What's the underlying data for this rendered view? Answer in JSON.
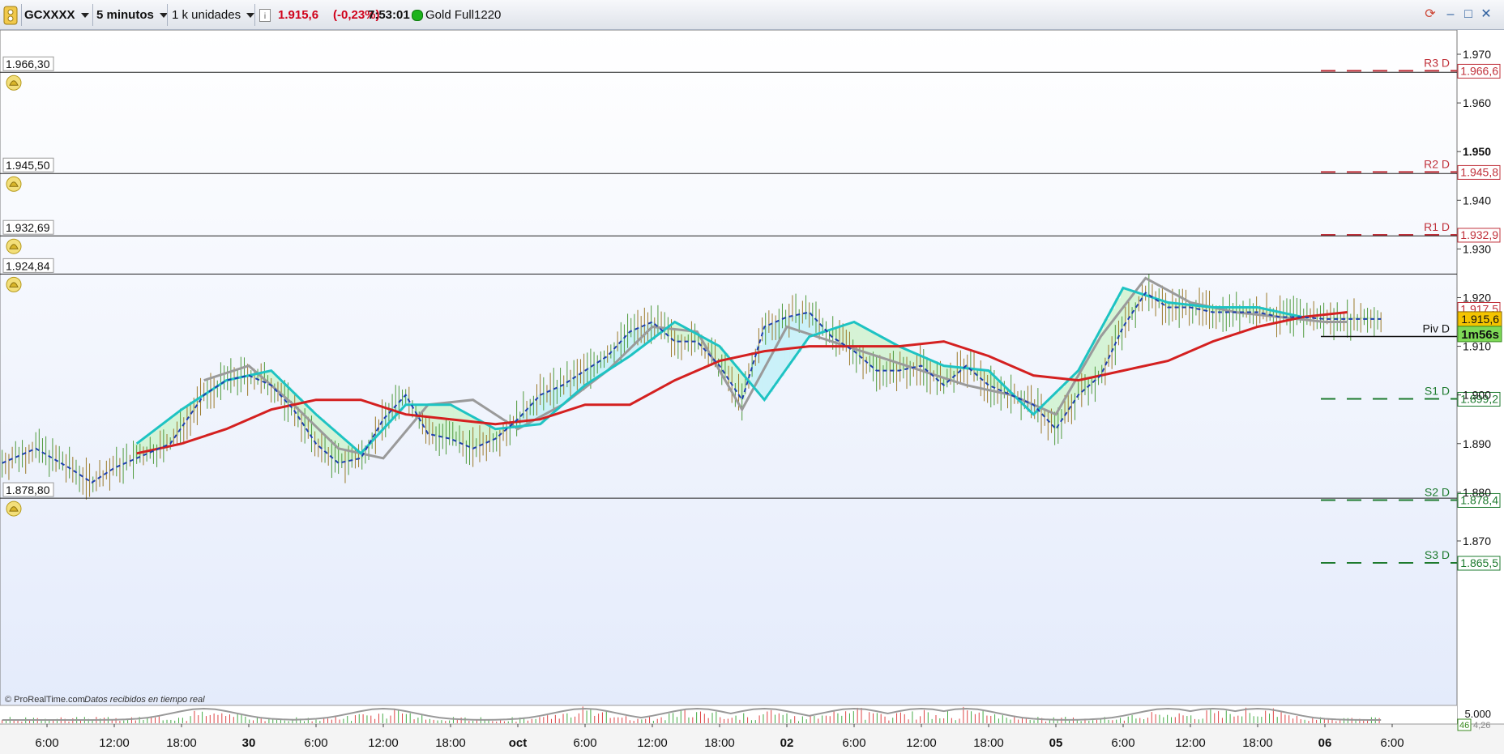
{
  "toolbar": {
    "instrument": "GCXXXX",
    "timeframe": "5 minutos",
    "units": "1 k unidades",
    "info_icon": "info-icon",
    "last_price": "1.915,6",
    "change": "(-0,23%)",
    "time": "7:53:01",
    "product": "Gold Full1220",
    "status_color": "#1db31d",
    "change_color": "#d0021b"
  },
  "footer": {
    "brand": "© ProRealTime.com",
    "note": "Datos recibidos en tiempo real"
  },
  "chart_data": {
    "type": "line",
    "title": "",
    "ylim": [
      1858,
      1975
    ],
    "y_ticks": [
      "1.970",
      "1.960",
      "1.950",
      "1.940",
      "1.930",
      "1.920",
      "1.910",
      "1.900",
      "1.890",
      "1.880",
      "1.870"
    ],
    "y_tick_values": [
      1970,
      1960,
      1950,
      1940,
      1930,
      1920,
      1910,
      1900,
      1890,
      1880,
      1870
    ],
    "y_tick_bold": "1.950",
    "x_ticks": [
      "6:00",
      "12:00",
      "18:00",
      "30",
      "6:00",
      "12:00",
      "18:00",
      "oct",
      "6:00",
      "12:00",
      "18:00",
      "02",
      "6:00",
      "12:00",
      "18:00",
      "05",
      "6:00",
      "12:00",
      "18:00",
      "06",
      "6:00"
    ],
    "x_tick_bold": [
      "30",
      "oct",
      "02",
      "05",
      "06"
    ],
    "x_tick_index": [
      0,
      6,
      12,
      18,
      24,
      30,
      36,
      42,
      48,
      54,
      60,
      66,
      72,
      78,
      84,
      90,
      96,
      102,
      108,
      114,
      120
    ],
    "x_range_index": [
      -4,
      124
    ],
    "alert_lines": [
      {
        "label": "1.966,30",
        "value": 1966.3
      },
      {
        "label": "1.945,50",
        "value": 1945.5
      },
      {
        "label": "1.932,69",
        "value": 1932.69
      },
      {
        "label": "1.924,84",
        "value": 1924.84
      },
      {
        "label": "1.878,80",
        "value": 1878.8
      }
    ],
    "pivot_levels": [
      {
        "name": "R3 D",
        "label": "1.966,6",
        "value": 1966.6,
        "color": "#c0303a"
      },
      {
        "name": "R2 D",
        "label": "1.945,8",
        "value": 1945.8,
        "color": "#c0303a"
      },
      {
        "name": "R1 D",
        "label": "1.932,9",
        "value": 1932.9,
        "color": "#c0303a"
      },
      {
        "name": "Piv D",
        "label": "",
        "value": 1912.0,
        "color": "#111111"
      },
      {
        "name": "S1 D",
        "label": "1.899,2",
        "value": 1899.2,
        "color": "#1d7a2e"
      },
      {
        "name": "S2 D",
        "label": "1.878,4",
        "value": 1878.4,
        "color": "#1d7a2e"
      },
      {
        "name": "S3 D",
        "label": "1.865,5",
        "value": 1865.5,
        "color": "#1d7a2e"
      }
    ],
    "current_price_label": "1.915,6",
    "current_price": 1915.6,
    "countdown_label": "1m56s",
    "secondary_label": "1.917,5",
    "secondary_value": 1917.5,
    "price_series": {
      "x": [
        -4,
        -1,
        2,
        4,
        6,
        9,
        11,
        14,
        16,
        18,
        20,
        22,
        24,
        26,
        28,
        30,
        32,
        34,
        36,
        38,
        40,
        42,
        44,
        46,
        48,
        50,
        52,
        54,
        56,
        58,
        60,
        62,
        64,
        66,
        68,
        70,
        72,
        74,
        76,
        78,
        80,
        82,
        84,
        86,
        88,
        90,
        92,
        94,
        96,
        98,
        100,
        102,
        104,
        106,
        108,
        110,
        112,
        114,
        116,
        118,
        119
      ],
      "values": [
        1886,
        1889,
        1885,
        1882,
        1885,
        1888,
        1890,
        1900,
        1903,
        1904,
        1902,
        1897,
        1890,
        1886,
        1887,
        1895,
        1900,
        1892,
        1891,
        1889,
        1891,
        1895,
        1900,
        1902,
        1905,
        1908,
        1913,
        1915,
        1911,
        1911,
        1906,
        1899,
        1914,
        1916,
        1917,
        1912,
        1909,
        1905,
        1905,
        1906,
        1902,
        1906,
        1902,
        1900,
        1898,
        1893,
        1900,
        1904,
        1914,
        1921,
        1918,
        1918,
        1917,
        1917,
        1917,
        1916,
        1916,
        1915.6,
        1915.6,
        1915.6,
        1915.6
      ],
      "color": "#1e3fae"
    },
    "ma_cyan": {
      "x": [
        8,
        12,
        16,
        20,
        24,
        28,
        32,
        36,
        40,
        44,
        48,
        52,
        56,
        60,
        64,
        68,
        72,
        76,
        80,
        84,
        88,
        92,
        96,
        100,
        104,
        108,
        112
      ],
      "values": [
        1890,
        1897,
        1903,
        1905,
        1896,
        1888,
        1898,
        1898,
        1893,
        1894,
        1902,
        1908,
        1915,
        1910,
        1899,
        1912,
        1915,
        1910,
        1906,
        1905,
        1896,
        1905,
        1922,
        1919,
        1918,
        1918,
        1916
      ],
      "color": "#1ec3c3"
    },
    "ma_gray": {
      "x": [
        14,
        18,
        22,
        26,
        30,
        34,
        38,
        42,
        46,
        50,
        54,
        58,
        62,
        66,
        70,
        74,
        78,
        82,
        86,
        90,
        94,
        98,
        102,
        106,
        110,
        114,
        116
      ],
      "values": [
        1903,
        1906,
        1898,
        1889,
        1887,
        1898,
        1899,
        1893,
        1898,
        1905,
        1914,
        1913,
        1897,
        1914,
        1911,
        1908,
        1905,
        1902,
        1900,
        1896,
        1912,
        1924,
        1919,
        1917,
        1916,
        1915,
        1915
      ],
      "color": "#9a9a9a"
    },
    "ma_red": {
      "x": [
        8,
        12,
        16,
        20,
        24,
        28,
        32,
        36,
        40,
        44,
        48,
        52,
        56,
        60,
        64,
        68,
        72,
        76,
        80,
        84,
        88,
        92,
        96,
        100,
        104,
        108,
        112,
        116
      ],
      "values": [
        1888,
        1890,
        1893,
        1897,
        1899,
        1899,
        1896,
        1895,
        1894,
        1895,
        1898,
        1898,
        1903,
        1907,
        1909,
        1910,
        1910,
        1910,
        1911,
        1908,
        1904,
        1903,
        1905,
        1907,
        1911,
        1914,
        1916,
        1917
      ],
      "color": "#d42020"
    },
    "volume_axis": {
      "label": "5.000",
      "value_label": "46",
      "secondary": "4,26"
    }
  }
}
